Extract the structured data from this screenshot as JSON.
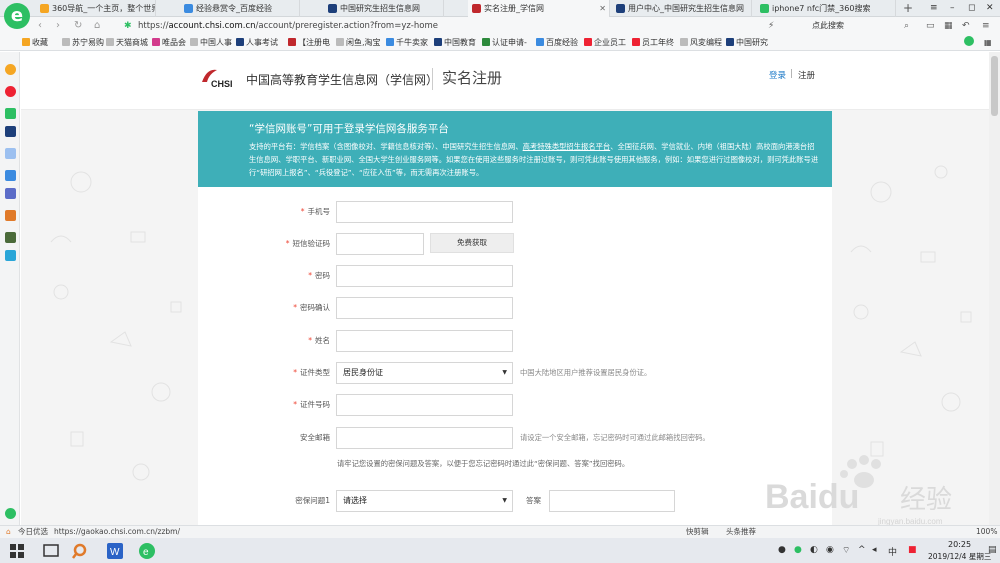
{
  "tabs": [
    {
      "title": "360导航_一个主页，整个世界",
      "active": false,
      "color": "#f5a623"
    },
    {
      "title": "经验悬赏令_百度经验",
      "active": false,
      "color": "#3b8be0"
    },
    {
      "title": "中国研究生招生信息网",
      "active": false,
      "color": "#1d3f7a"
    },
    {
      "title": "实名注册_学信网",
      "active": true,
      "color": "#c0282d"
    },
    {
      "title": "用户中心_中国研究生招生信息网",
      "active": false,
      "color": "#1d3f7a"
    },
    {
      "title": "iphone7 nfc门禁_360搜索",
      "active": false,
      "color": "#2dbf63"
    }
  ],
  "window": {
    "minimize": "–",
    "restore": "◻",
    "close": "✕"
  },
  "addr": {
    "scheme": "https://",
    "host": "account.chsi.com.cn",
    "path": "/account/preregister.action?from=yz-home",
    "search_placeholder": "点此搜索"
  },
  "logo_letter": "e",
  "bookmarks": [
    {
      "label": "收藏",
      "color": "#f5a623"
    },
    {
      "label": "苏宁易购",
      "color": "#999"
    },
    {
      "label": "天猫商城",
      "color": "#999"
    },
    {
      "label": "唯品会",
      "color": "#d23b8c"
    },
    {
      "label": "中国人事",
      "color": "#999"
    },
    {
      "label": "人事考试",
      "color": "#1d3f7a"
    },
    {
      "label": "【注册电",
      "color": "#c0282d"
    },
    {
      "label": "闲鱼,淘宝",
      "color": "#999"
    },
    {
      "label": "千牛卖家",
      "color": "#3b8be0"
    },
    {
      "label": "中国教育",
      "color": "#1d3f7a"
    },
    {
      "label": "认证申请-",
      "color": "#2d8a3c"
    },
    {
      "label": "百度经验",
      "color": "#3b8be0"
    },
    {
      "label": "企业员工",
      "color": "#e23"
    },
    {
      "label": "员工年终",
      "color": "#e23"
    },
    {
      "label": "风変编程",
      "color": "#999"
    },
    {
      "label": "中国研究",
      "color": "#1d3f7a"
    }
  ],
  "header": {
    "site_name": "中国高等教育学生信息网（学信网）",
    "page_title": "实名注册",
    "login": "登录",
    "separator": "|",
    "register": "注册"
  },
  "banner": {
    "title": "“学信网账号”可用于登录学信网各服务平台",
    "text_a": "支持的平台有：学信档案（含图像校对、学籍信息核对等）、中国研究生招生信息网、",
    "link": "高考特殊类型招生报名平台",
    "text_b": "、全国征兵网、学信就业、内地（祖国大陆）高校面向港澳台招生信息网、学职平台、新职业网、全国大学生创业服务网等。如果您在使用这些服务时注册过账号，则可凭此账号使用其他服务，例如：如果您进行过图像校对，则可凭此账号进行“研招网上报名”、“兵役登记”、“应征入伍”等，而无需再次注册账号。"
  },
  "form": {
    "phone_label": "手机号",
    "sms_label": "短信验证码",
    "sms_button": "免费获取",
    "password_label": "密码",
    "password_confirm_label": "密码确认",
    "name_label": "姓名",
    "id_type_label": "证件类型",
    "id_type_value": "居民身份证",
    "id_type_hint": "中国大陆地区用户推荐设置居民身份证。",
    "id_number_label": "证件号码",
    "email_label": "安全邮箱",
    "email_hint": "请设定一个安全邮箱，忘记密码时可通过此邮箱找回密码。",
    "notice": "请牢记您设置的密保问题及答案，以便于您忘记密码时通过此“密保问题、答案”找回密码。",
    "q1_label": "密保问题1",
    "q1_value": "请选择",
    "answer_label": "答案",
    "required_mark": "*"
  },
  "watermark": {
    "brand": "Baidu",
    "suffix": "经验",
    "sub": "jingyan.baidu.com"
  },
  "status": {
    "left": "今日优选",
    "url": "https://gaokao.chsi.com.cn/zzbm/",
    "right1": "快剪辑",
    "right2": "头条推荐",
    "zoom": "100%"
  },
  "clock": {
    "time": "20:25",
    "date": "2019/12/4 星期三"
  },
  "tray": {
    "lang": "中"
  }
}
